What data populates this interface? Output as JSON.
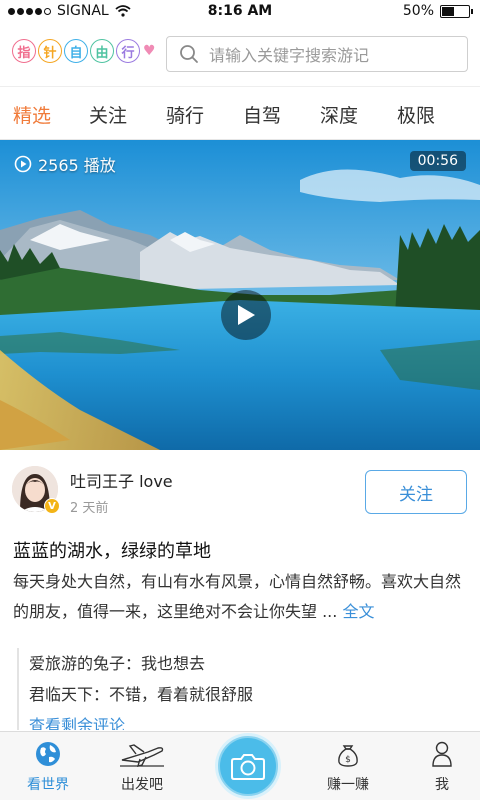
{
  "status_bar": {
    "carrier": "SIGNAL",
    "time": "8:16 AM",
    "battery": "50%",
    "battery_level": 0.5
  },
  "header": {
    "logo_chars": [
      "指",
      "针",
      "自",
      "由",
      "行"
    ],
    "logo_colors": [
      "#f06e8e",
      "#f5a623",
      "#3fb0e8",
      "#4fc3a1",
      "#9b7be0"
    ],
    "search_placeholder": "请输入关键字搜索游记"
  },
  "tabs": [
    {
      "label": "精选",
      "active": true
    },
    {
      "label": "关注",
      "active": false
    },
    {
      "label": "骑行",
      "active": false
    },
    {
      "label": "自驾",
      "active": false
    },
    {
      "label": "深度",
      "active": false
    },
    {
      "label": "极限",
      "active": false
    }
  ],
  "video": {
    "plays": "2565 播放",
    "duration": "00:56"
  },
  "post": {
    "author": "吐司王子 love",
    "badge": "V",
    "time": "2 天前",
    "follow_label": "关注",
    "title": "蓝蓝的湖水，绿绿的草地",
    "body": "每天身处大自然，有山有水有风景，心情自然舒畅。喜欢大自然的朋友，值得一来，这里绝对不会让你失望 ...",
    "full_text_label": "全文"
  },
  "comments": [
    {
      "text": "爱旅游的兔子：我也想去"
    },
    {
      "text": "君临天下：不错，看着就很舒服"
    }
  ],
  "more_comments_label": "查看剩余评论",
  "bottom_nav": {
    "items": [
      {
        "label": "看世界",
        "active": true
      },
      {
        "label": "出发吧",
        "active": false
      },
      {
        "label": "赚一赚",
        "active": false
      },
      {
        "label": "我",
        "active": false
      }
    ]
  },
  "colors": {
    "accent_orange": "#f07b3a",
    "accent_blue": "#3a8fd8",
    "camera_blue": "#4bbce9"
  }
}
